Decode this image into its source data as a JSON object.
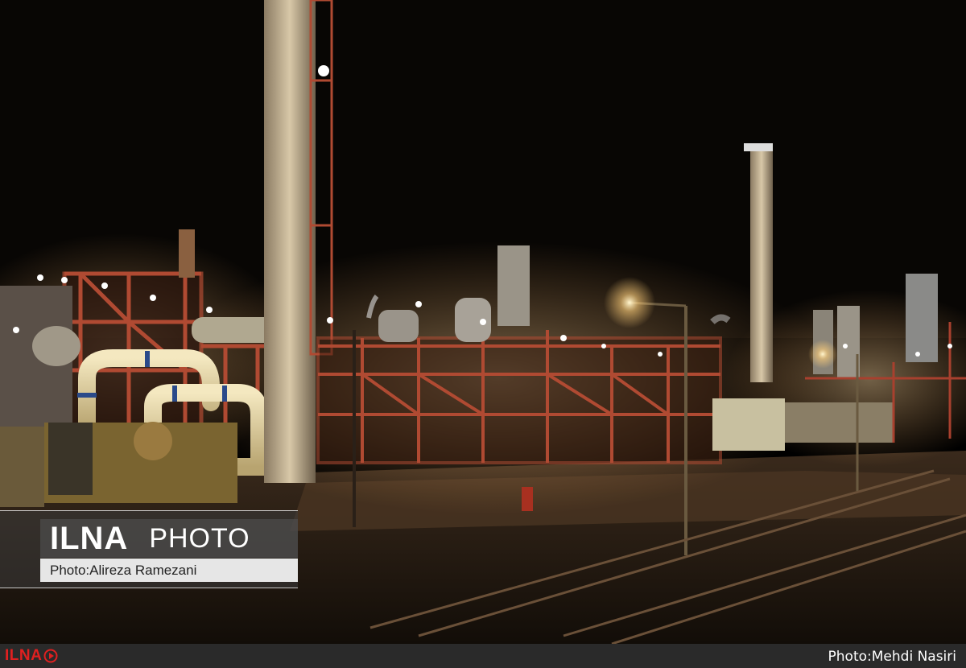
{
  "watermark": {
    "brand": "ILNA",
    "label": "PHOTO",
    "credit": "Photo:Alireza Ramezani"
  },
  "footer": {
    "logo": "ILNA",
    "logo_icon": "play-arrow-icon",
    "credit": "Photo:Mehdi Nasiri"
  },
  "colors": {
    "sky": "#000000",
    "steel_red": "#a8402e",
    "lamp_glow": "#ffcf7a",
    "pipe_cream": "#e8d9a8",
    "footer_bg": "#2a2a2a",
    "logo_red": "#e02020"
  }
}
